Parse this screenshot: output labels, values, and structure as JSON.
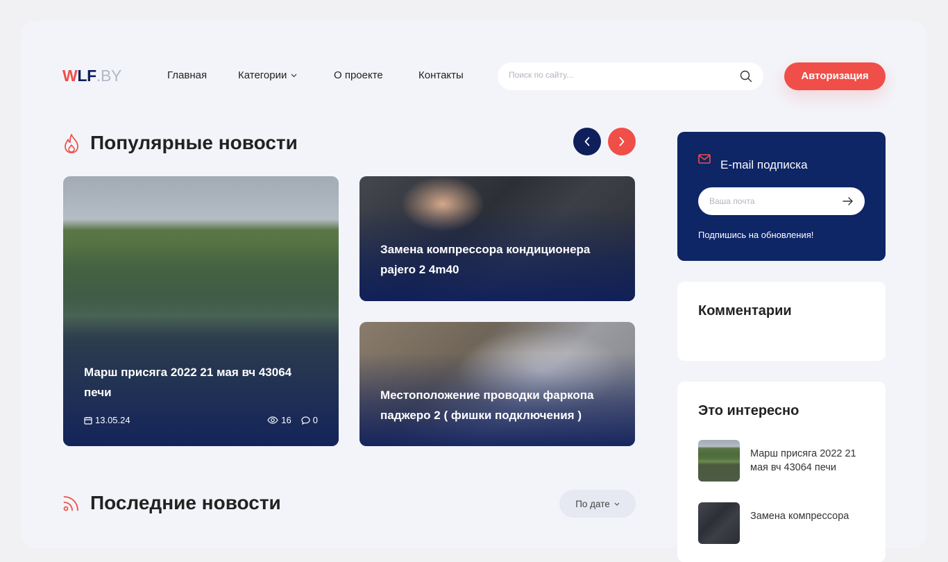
{
  "logo": {
    "part1": "W",
    "part2": "LF",
    "part3": ".BY"
  },
  "nav": [
    {
      "label": "Главная"
    },
    {
      "label": "Категории"
    },
    {
      "label": "О проекте"
    },
    {
      "label": "Контакты"
    }
  ],
  "search": {
    "placeholder": "Поиск по сайту..."
  },
  "auth": {
    "label": "Авторизация"
  },
  "popular": {
    "title": "Популярные новости",
    "cards": [
      {
        "title": "Марш присяга 2022 21 мая вч 43064 печи",
        "date": "13.05.24",
        "views": "16",
        "comments": "0"
      },
      {
        "title": "Замена компрессора кондиционера pajero 2 4m40"
      },
      {
        "title": "Местоположение проводки фаркопа паджеро 2 ( фишки подключения )"
      }
    ]
  },
  "latest": {
    "title": "Последние новости",
    "sort_label": "По дате"
  },
  "subscribe": {
    "title": "E-mail подписка",
    "placeholder": "Ваша почта",
    "hint": "Подпишись на обновления!"
  },
  "comments": {
    "title": "Комментарии"
  },
  "interesting": {
    "title": "Это интересно",
    "items": [
      {
        "text": "Марш присяга 2022 21 мая вч 43064 печи"
      },
      {
        "text": "Замена компрессора"
      }
    ]
  },
  "colors": {
    "accent": "#ef4f48",
    "navy": "#0e1f5c",
    "background": "#f3f4f9"
  }
}
